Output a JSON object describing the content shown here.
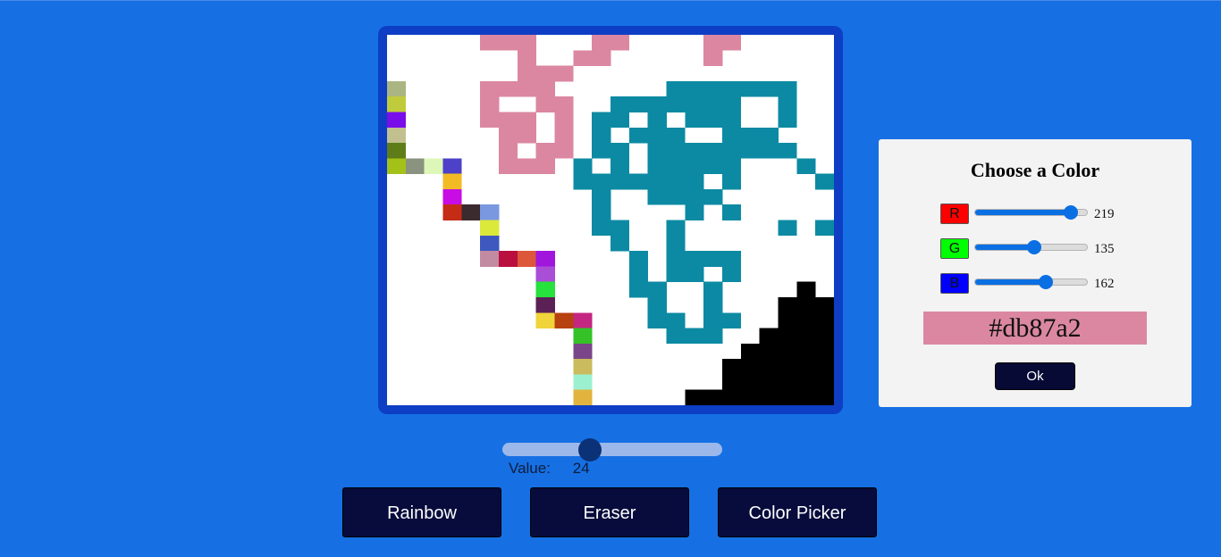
{
  "board": {
    "background": "#ffffff",
    "frame_color": "#0d3ec4",
    "grid_size": 24,
    "pixels": [
      {
        "col": 5,
        "row": 0,
        "color": "#db87a2"
      },
      {
        "col": 6,
        "row": 0,
        "color": "#db87a2"
      },
      {
        "col": 7,
        "row": 0,
        "color": "#db87a2"
      },
      {
        "col": 11,
        "row": 0,
        "color": "#db87a2"
      },
      {
        "col": 12,
        "row": 0,
        "color": "#db87a2"
      },
      {
        "col": 17,
        "row": 0,
        "color": "#db87a2"
      },
      {
        "col": 18,
        "row": 0,
        "color": "#db87a2"
      },
      {
        "col": 7,
        "row": 1,
        "color": "#db87a2"
      },
      {
        "col": 10,
        "row": 1,
        "color": "#db87a2"
      },
      {
        "col": 11,
        "row": 1,
        "color": "#db87a2"
      },
      {
        "col": 17,
        "row": 1,
        "color": "#db87a2"
      },
      {
        "col": 7,
        "row": 2,
        "color": "#db87a2"
      },
      {
        "col": 8,
        "row": 2,
        "color": "#db87a2"
      },
      {
        "col": 9,
        "row": 2,
        "color": "#db87a2"
      },
      {
        "col": 0,
        "row": 3,
        "color": "#aab581"
      },
      {
        "col": 5,
        "row": 3,
        "color": "#db87a2"
      },
      {
        "col": 6,
        "row": 3,
        "color": "#db87a2"
      },
      {
        "col": 7,
        "row": 3,
        "color": "#db87a2"
      },
      {
        "col": 8,
        "row": 3,
        "color": "#db87a2"
      },
      {
        "col": 15,
        "row": 3,
        "color": "#0c8aa3"
      },
      {
        "col": 16,
        "row": 3,
        "color": "#0c8aa3"
      },
      {
        "col": 17,
        "row": 3,
        "color": "#0c8aa3"
      },
      {
        "col": 18,
        "row": 3,
        "color": "#0c8aa3"
      },
      {
        "col": 19,
        "row": 3,
        "color": "#0c8aa3"
      },
      {
        "col": 20,
        "row": 3,
        "color": "#0c8aa3"
      },
      {
        "col": 21,
        "row": 3,
        "color": "#0c8aa3"
      },
      {
        "col": 0,
        "row": 4,
        "color": "#c0cb3b"
      },
      {
        "col": 5,
        "row": 4,
        "color": "#db87a2"
      },
      {
        "col": 8,
        "row": 4,
        "color": "#db87a2"
      },
      {
        "col": 9,
        "row": 4,
        "color": "#db87a2"
      },
      {
        "col": 12,
        "row": 4,
        "color": "#0c8aa3"
      },
      {
        "col": 13,
        "row": 4,
        "color": "#0c8aa3"
      },
      {
        "col": 14,
        "row": 4,
        "color": "#0c8aa3"
      },
      {
        "col": 15,
        "row": 4,
        "color": "#0c8aa3"
      },
      {
        "col": 16,
        "row": 4,
        "color": "#0c8aa3"
      },
      {
        "col": 17,
        "row": 4,
        "color": "#0c8aa3"
      },
      {
        "col": 18,
        "row": 4,
        "color": "#0c8aa3"
      },
      {
        "col": 21,
        "row": 4,
        "color": "#0c8aa3"
      },
      {
        "col": 0,
        "row": 5,
        "color": "#7a0eeb"
      },
      {
        "col": 5,
        "row": 5,
        "color": "#db87a2"
      },
      {
        "col": 6,
        "row": 5,
        "color": "#db87a2"
      },
      {
        "col": 7,
        "row": 5,
        "color": "#db87a2"
      },
      {
        "col": 9,
        "row": 5,
        "color": "#db87a2"
      },
      {
        "col": 11,
        "row": 5,
        "color": "#0c8aa3"
      },
      {
        "col": 12,
        "row": 5,
        "color": "#0c8aa3"
      },
      {
        "col": 14,
        "row": 5,
        "color": "#0c8aa3"
      },
      {
        "col": 16,
        "row": 5,
        "color": "#0c8aa3"
      },
      {
        "col": 17,
        "row": 5,
        "color": "#0c8aa3"
      },
      {
        "col": 18,
        "row": 5,
        "color": "#0c8aa3"
      },
      {
        "col": 21,
        "row": 5,
        "color": "#0c8aa3"
      },
      {
        "col": 0,
        "row": 6,
        "color": "#c1c08e"
      },
      {
        "col": 6,
        "row": 6,
        "color": "#db87a2"
      },
      {
        "col": 7,
        "row": 6,
        "color": "#db87a2"
      },
      {
        "col": 9,
        "row": 6,
        "color": "#db87a2"
      },
      {
        "col": 11,
        "row": 6,
        "color": "#0c8aa3"
      },
      {
        "col": 13,
        "row": 6,
        "color": "#0c8aa3"
      },
      {
        "col": 14,
        "row": 6,
        "color": "#0c8aa3"
      },
      {
        "col": 15,
        "row": 6,
        "color": "#0c8aa3"
      },
      {
        "col": 18,
        "row": 6,
        "color": "#0c8aa3"
      },
      {
        "col": 19,
        "row": 6,
        "color": "#0c8aa3"
      },
      {
        "col": 20,
        "row": 6,
        "color": "#0c8aa3"
      },
      {
        "col": 0,
        "row": 7,
        "color": "#5e7d19"
      },
      {
        "col": 6,
        "row": 7,
        "color": "#db87a2"
      },
      {
        "col": 8,
        "row": 7,
        "color": "#db87a2"
      },
      {
        "col": 9,
        "row": 7,
        "color": "#db87a2"
      },
      {
        "col": 11,
        "row": 7,
        "color": "#0c8aa3"
      },
      {
        "col": 12,
        "row": 7,
        "color": "#0c8aa3"
      },
      {
        "col": 14,
        "row": 7,
        "color": "#0c8aa3"
      },
      {
        "col": 15,
        "row": 7,
        "color": "#0c8aa3"
      },
      {
        "col": 16,
        "row": 7,
        "color": "#0c8aa3"
      },
      {
        "col": 17,
        "row": 7,
        "color": "#0c8aa3"
      },
      {
        "col": 18,
        "row": 7,
        "color": "#0c8aa3"
      },
      {
        "col": 19,
        "row": 7,
        "color": "#0c8aa3"
      },
      {
        "col": 20,
        "row": 7,
        "color": "#0c8aa3"
      },
      {
        "col": 21,
        "row": 7,
        "color": "#0c8aa3"
      },
      {
        "col": 0,
        "row": 8,
        "color": "#a4c118"
      },
      {
        "col": 1,
        "row": 8,
        "color": "#8a9280"
      },
      {
        "col": 2,
        "row": 8,
        "color": "#ddf7b8"
      },
      {
        "col": 3,
        "row": 8,
        "color": "#4d40c9"
      },
      {
        "col": 6,
        "row": 8,
        "color": "#db87a2"
      },
      {
        "col": 7,
        "row": 8,
        "color": "#db87a2"
      },
      {
        "col": 8,
        "row": 8,
        "color": "#db87a2"
      },
      {
        "col": 10,
        "row": 8,
        "color": "#0c8aa3"
      },
      {
        "col": 12,
        "row": 8,
        "color": "#0c8aa3"
      },
      {
        "col": 14,
        "row": 8,
        "color": "#0c8aa3"
      },
      {
        "col": 15,
        "row": 8,
        "color": "#0c8aa3"
      },
      {
        "col": 16,
        "row": 8,
        "color": "#0c8aa3"
      },
      {
        "col": 17,
        "row": 8,
        "color": "#0c8aa3"
      },
      {
        "col": 18,
        "row": 8,
        "color": "#0c8aa3"
      },
      {
        "col": 22,
        "row": 8,
        "color": "#0c8aa3"
      },
      {
        "col": 3,
        "row": 9,
        "color": "#f2bb23"
      },
      {
        "col": 10,
        "row": 9,
        "color": "#0c8aa3"
      },
      {
        "col": 11,
        "row": 9,
        "color": "#0c8aa3"
      },
      {
        "col": 12,
        "row": 9,
        "color": "#0c8aa3"
      },
      {
        "col": 13,
        "row": 9,
        "color": "#0c8aa3"
      },
      {
        "col": 14,
        "row": 9,
        "color": "#0c8aa3"
      },
      {
        "col": 15,
        "row": 9,
        "color": "#0c8aa3"
      },
      {
        "col": 16,
        "row": 9,
        "color": "#0c8aa3"
      },
      {
        "col": 18,
        "row": 9,
        "color": "#0c8aa3"
      },
      {
        "col": 23,
        "row": 9,
        "color": "#0c8aa3"
      },
      {
        "col": 3,
        "row": 10,
        "color": "#c80de4"
      },
      {
        "col": 11,
        "row": 10,
        "color": "#0c8aa3"
      },
      {
        "col": 14,
        "row": 10,
        "color": "#0c8aa3"
      },
      {
        "col": 15,
        "row": 10,
        "color": "#0c8aa3"
      },
      {
        "col": 16,
        "row": 10,
        "color": "#0c8aa3"
      },
      {
        "col": 17,
        "row": 10,
        "color": "#0c8aa3"
      },
      {
        "col": 3,
        "row": 11,
        "color": "#c42c16"
      },
      {
        "col": 4,
        "row": 11,
        "color": "#3b2a2e"
      },
      {
        "col": 5,
        "row": 11,
        "color": "#7a98e0"
      },
      {
        "col": 11,
        "row": 11,
        "color": "#0c8aa3"
      },
      {
        "col": 16,
        "row": 11,
        "color": "#0c8aa3"
      },
      {
        "col": 18,
        "row": 11,
        "color": "#0c8aa3"
      },
      {
        "col": 5,
        "row": 12,
        "color": "#dbe93b"
      },
      {
        "col": 11,
        "row": 12,
        "color": "#0c8aa3"
      },
      {
        "col": 12,
        "row": 12,
        "color": "#0c8aa3"
      },
      {
        "col": 15,
        "row": 12,
        "color": "#0c8aa3"
      },
      {
        "col": 21,
        "row": 12,
        "color": "#0c8aa3"
      },
      {
        "col": 23,
        "row": 12,
        "color": "#0c8aa3"
      },
      {
        "col": 5,
        "row": 13,
        "color": "#3e58c0"
      },
      {
        "col": 12,
        "row": 13,
        "color": "#0c8aa3"
      },
      {
        "col": 15,
        "row": 13,
        "color": "#0c8aa3"
      },
      {
        "col": 5,
        "row": 14,
        "color": "#c38ba1"
      },
      {
        "col": 6,
        "row": 14,
        "color": "#b9103f"
      },
      {
        "col": 7,
        "row": 14,
        "color": "#dd573b"
      },
      {
        "col": 8,
        "row": 14,
        "color": "#a116dd"
      },
      {
        "col": 13,
        "row": 14,
        "color": "#0c8aa3"
      },
      {
        "col": 15,
        "row": 14,
        "color": "#0c8aa3"
      },
      {
        "col": 16,
        "row": 14,
        "color": "#0c8aa3"
      },
      {
        "col": 17,
        "row": 14,
        "color": "#0c8aa3"
      },
      {
        "col": 18,
        "row": 14,
        "color": "#0c8aa3"
      },
      {
        "col": 8,
        "row": 15,
        "color": "#a94ed6"
      },
      {
        "col": 13,
        "row": 15,
        "color": "#0c8aa3"
      },
      {
        "col": 15,
        "row": 15,
        "color": "#0c8aa3"
      },
      {
        "col": 16,
        "row": 15,
        "color": "#0c8aa3"
      },
      {
        "col": 18,
        "row": 15,
        "color": "#0c8aa3"
      },
      {
        "col": 8,
        "row": 16,
        "color": "#27e13d"
      },
      {
        "col": 13,
        "row": 16,
        "color": "#0c8aa3"
      },
      {
        "col": 14,
        "row": 16,
        "color": "#0c8aa3"
      },
      {
        "col": 17,
        "row": 16,
        "color": "#0c8aa3"
      },
      {
        "col": 22,
        "row": 16,
        "color": "#000000"
      },
      {
        "col": 8,
        "row": 17,
        "color": "#5b2157"
      },
      {
        "col": 14,
        "row": 17,
        "color": "#0c8aa3"
      },
      {
        "col": 17,
        "row": 17,
        "color": "#0c8aa3"
      },
      {
        "col": 21,
        "row": 17,
        "color": "#000000"
      },
      {
        "col": 22,
        "row": 17,
        "color": "#000000"
      },
      {
        "col": 23,
        "row": 17,
        "color": "#000000"
      },
      {
        "col": 8,
        "row": 18,
        "color": "#f0d43a"
      },
      {
        "col": 9,
        "row": 18,
        "color": "#b7410f"
      },
      {
        "col": 10,
        "row": 18,
        "color": "#c42682"
      },
      {
        "col": 14,
        "row": 18,
        "color": "#0c8aa3"
      },
      {
        "col": 15,
        "row": 18,
        "color": "#0c8aa3"
      },
      {
        "col": 17,
        "row": 18,
        "color": "#0c8aa3"
      },
      {
        "col": 18,
        "row": 18,
        "color": "#0c8aa3"
      },
      {
        "col": 21,
        "row": 18,
        "color": "#000000"
      },
      {
        "col": 22,
        "row": 18,
        "color": "#000000"
      },
      {
        "col": 23,
        "row": 18,
        "color": "#000000"
      },
      {
        "col": 10,
        "row": 19,
        "color": "#35c227"
      },
      {
        "col": 15,
        "row": 19,
        "color": "#0c8aa3"
      },
      {
        "col": 16,
        "row": 19,
        "color": "#0c8aa3"
      },
      {
        "col": 17,
        "row": 19,
        "color": "#0c8aa3"
      },
      {
        "col": 20,
        "row": 19,
        "color": "#000000"
      },
      {
        "col": 21,
        "row": 19,
        "color": "#000000"
      },
      {
        "col": 22,
        "row": 19,
        "color": "#000000"
      },
      {
        "col": 23,
        "row": 19,
        "color": "#000000"
      },
      {
        "col": 10,
        "row": 20,
        "color": "#7a4689"
      },
      {
        "col": 19,
        "row": 20,
        "color": "#000000"
      },
      {
        "col": 20,
        "row": 20,
        "color": "#000000"
      },
      {
        "col": 21,
        "row": 20,
        "color": "#000000"
      },
      {
        "col": 22,
        "row": 20,
        "color": "#000000"
      },
      {
        "col": 23,
        "row": 20,
        "color": "#000000"
      },
      {
        "col": 10,
        "row": 21,
        "color": "#c9bb5e"
      },
      {
        "col": 18,
        "row": 21,
        "color": "#000000"
      },
      {
        "col": 19,
        "row": 21,
        "color": "#000000"
      },
      {
        "col": 20,
        "row": 21,
        "color": "#000000"
      },
      {
        "col": 21,
        "row": 21,
        "color": "#000000"
      },
      {
        "col": 22,
        "row": 21,
        "color": "#000000"
      },
      {
        "col": 23,
        "row": 21,
        "color": "#000000"
      },
      {
        "col": 10,
        "row": 22,
        "color": "#9bf1cf"
      },
      {
        "col": 18,
        "row": 22,
        "color": "#000000"
      },
      {
        "col": 19,
        "row": 22,
        "color": "#000000"
      },
      {
        "col": 20,
        "row": 22,
        "color": "#000000"
      },
      {
        "col": 21,
        "row": 22,
        "color": "#000000"
      },
      {
        "col": 22,
        "row": 22,
        "color": "#000000"
      },
      {
        "col": 23,
        "row": 22,
        "color": "#000000"
      },
      {
        "col": 10,
        "row": 23,
        "color": "#e2b43d"
      },
      {
        "col": 16,
        "row": 23,
        "color": "#000000"
      },
      {
        "col": 17,
        "row": 23,
        "color": "#000000"
      },
      {
        "col": 18,
        "row": 23,
        "color": "#000000"
      },
      {
        "col": 19,
        "row": 23,
        "color": "#000000"
      },
      {
        "col": 20,
        "row": 23,
        "color": "#000000"
      },
      {
        "col": 21,
        "row": 23,
        "color": "#000000"
      },
      {
        "col": 22,
        "row": 23,
        "color": "#000000"
      },
      {
        "col": 23,
        "row": 23,
        "color": "#000000"
      }
    ]
  },
  "size_control": {
    "value_label": "Value:",
    "value": "24",
    "fraction": 0.4
  },
  "buttons": {
    "rainbow": "Rainbow",
    "eraser": "Eraser",
    "color_picker": "Color Picker"
  },
  "picker": {
    "title": "Choose a Color",
    "channels": [
      {
        "label": "R",
        "value": "219",
        "color": "#ff0000",
        "fraction": 0.859
      },
      {
        "label": "G",
        "value": "135",
        "color": "#00ff00",
        "fraction": 0.529
      },
      {
        "label": "B",
        "value": "162",
        "color": "#0000ff",
        "fraction": 0.635
      }
    ],
    "hex": "#db87a2",
    "ok": "Ok"
  },
  "colors": {
    "page_background": "#1670e4",
    "button_background": "#070c3c",
    "slider_accent": "#0a6fe3"
  }
}
